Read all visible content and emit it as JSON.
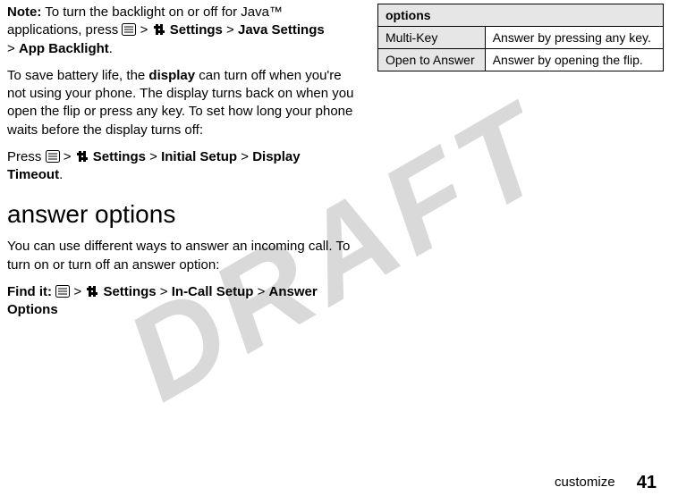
{
  "left": {
    "note_label": "Note:",
    "note_text": " To turn the backlight on or off for Java™ applications, press ",
    "gt": ">",
    "settings": "Settings",
    "java_settings": "Java Settings",
    "app_backlight": "App Backlight",
    "display_intro": "To save battery life, the ",
    "display_word": "display",
    "display_rest": " can turn off when you're not using your phone. The display turns back on when you open the flip or press any key. To set how long your phone waits before the display turns off:",
    "press_label": "Press ",
    "initial_setup": "Initial Setup",
    "display_timeout": "Display Timeout",
    "heading": "answer options",
    "answer_intro": "You can use different ways to answer an incoming call. To turn on or turn off an answer option:",
    "find_it_label": "Find it:",
    "in_call_setup": "In-Call Setup",
    "answer_options": "Answer Options"
  },
  "table": {
    "header": "options",
    "rows": [
      {
        "label": "Multi-Key",
        "desc": "Answer by pressing any key."
      },
      {
        "label": "Open to Answer",
        "desc": "Answer by opening the flip."
      }
    ]
  },
  "footer": {
    "section": "customize",
    "page": "41"
  },
  "watermark": "DRAFT"
}
